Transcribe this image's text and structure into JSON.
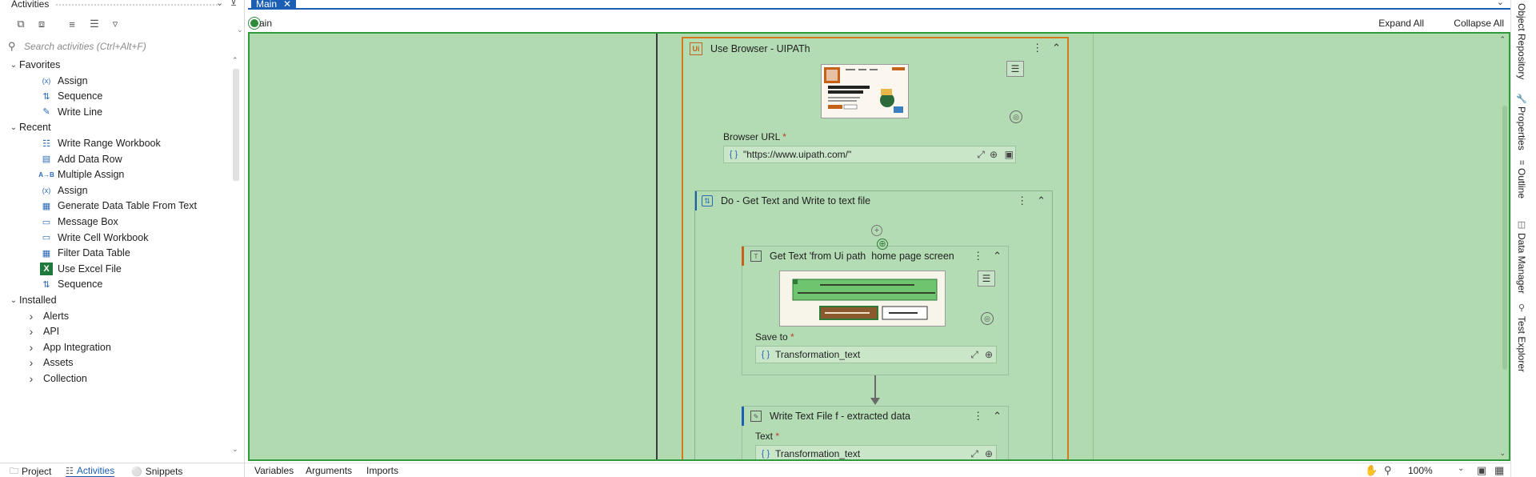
{
  "activities_panel": {
    "title": "Activities",
    "search_placeholder": "Search activities (Ctrl+Alt+F)",
    "tree": [
      {
        "kind": "group",
        "label": "Favorites",
        "expanded": true
      },
      {
        "kind": "item",
        "label": "Assign",
        "icon": "variable-x-icon"
      },
      {
        "kind": "item",
        "label": "Sequence",
        "icon": "sequence-icon"
      },
      {
        "kind": "item",
        "label": "Write Line",
        "icon": "write-line-icon"
      },
      {
        "kind": "group",
        "label": "Recent",
        "expanded": true
      },
      {
        "kind": "item",
        "label": "Write Range Workbook",
        "icon": "range-icon"
      },
      {
        "kind": "item",
        "label": "Add Data Row",
        "icon": "datarow-icon"
      },
      {
        "kind": "item",
        "label": "Multiple Assign",
        "icon": "multi-assign-icon"
      },
      {
        "kind": "item",
        "label": "Assign",
        "icon": "variable-x-icon"
      },
      {
        "kind": "item",
        "label": "Generate Data Table From Text",
        "icon": "datatable-icon"
      },
      {
        "kind": "item",
        "label": "Message Box",
        "icon": "message-box-icon"
      },
      {
        "kind": "item",
        "label": "Write Cell Workbook",
        "icon": "cell-icon"
      },
      {
        "kind": "item",
        "label": "Filter Data Table",
        "icon": "filter-table-icon"
      },
      {
        "kind": "item",
        "label": "Use Excel File",
        "icon": "excel-icon"
      },
      {
        "kind": "item",
        "label": "Sequence",
        "icon": "sequence-icon"
      },
      {
        "kind": "group",
        "label": "Installed",
        "expanded": true
      },
      {
        "kind": "subgroup",
        "label": "Alerts"
      },
      {
        "kind": "subgroup",
        "label": "API"
      },
      {
        "kind": "subgroup",
        "label": "App Integration"
      },
      {
        "kind": "subgroup",
        "label": "Assets"
      },
      {
        "kind": "subgroup",
        "label": "Collection"
      }
    ],
    "bottom_tabs": [
      {
        "label": "Project",
        "icon": "folder-icon",
        "active": false
      },
      {
        "label": "Activities",
        "icon": "activities-icon",
        "active": true
      },
      {
        "label": "Snippets",
        "icon": "snippets-icon",
        "active": false
      }
    ]
  },
  "designer": {
    "tab": "Main",
    "breadcrumb": "ain",
    "expand_all": "Expand All",
    "collapse_all": "Collapse All",
    "use_browser": {
      "title": "Use Browser - UIPATh",
      "badge": "Ui",
      "url_label": "Browser URL",
      "url_value": "\"https://www.uipath.com/\""
    },
    "sequence": {
      "title": "Do - Get Text and Write to text file"
    },
    "get_text": {
      "title": "Get Text 'from Ui path  home page screen",
      "save_label": "Save to",
      "save_value": "Transformation_text"
    },
    "write_text": {
      "title": "Write Text File f - extracted data",
      "text_label": "Text",
      "text_value": "Transformation_text"
    },
    "required_mark": "*"
  },
  "right_dock": {
    "tabs": [
      {
        "label": "Object Repository",
        "icon": "object-repo-icon"
      },
      {
        "label": "Properties",
        "icon": "wrench-icon"
      },
      {
        "label": "Outline",
        "icon": "outline-icon"
      },
      {
        "label": "Data Manager",
        "icon": "data-manager-icon"
      },
      {
        "label": "Test Explorer",
        "icon": "test-explorer-icon"
      }
    ]
  },
  "statusbar": {
    "variables": "Variables",
    "arguments": "Arguments",
    "imports": "Imports",
    "zoom": "100%"
  },
  "colors": {
    "canvas": "#b1dab1",
    "canvas_border": "#2f9a3a",
    "browser_border": "#d47a1b",
    "accent_blue": "#1a5fb4"
  }
}
